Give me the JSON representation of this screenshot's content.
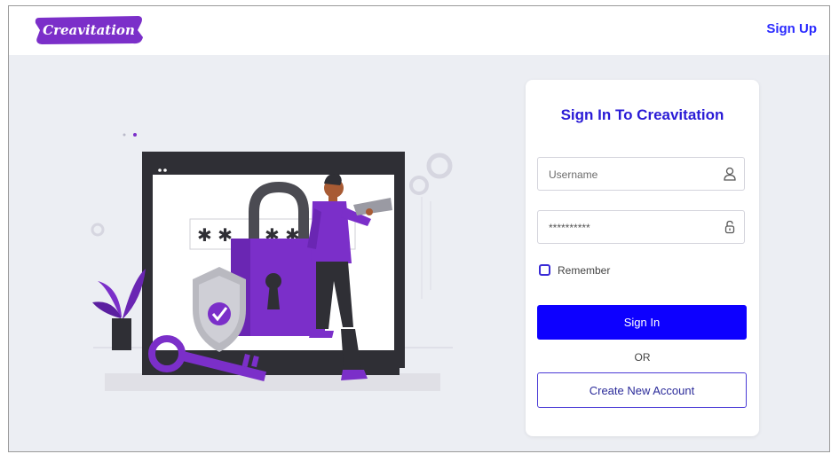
{
  "header": {
    "brand": "Creavitation",
    "signup_label": "Sign Up"
  },
  "login": {
    "title": "Sign In To Creavitation",
    "username_placeholder": "Username",
    "password_value": "**********",
    "remember_label": "Remember",
    "remember_checked": false,
    "signin_label": "Sign In",
    "or_label": "OR",
    "create_label": "Create New Account"
  },
  "icons": {
    "username": "user-icon",
    "password": "lock-icon"
  },
  "colors": {
    "brand": "#7b2fc9",
    "primary_button": "#0d00ff",
    "title": "#2a1bd6",
    "link": "#2b2bff",
    "background": "#eceef3"
  }
}
